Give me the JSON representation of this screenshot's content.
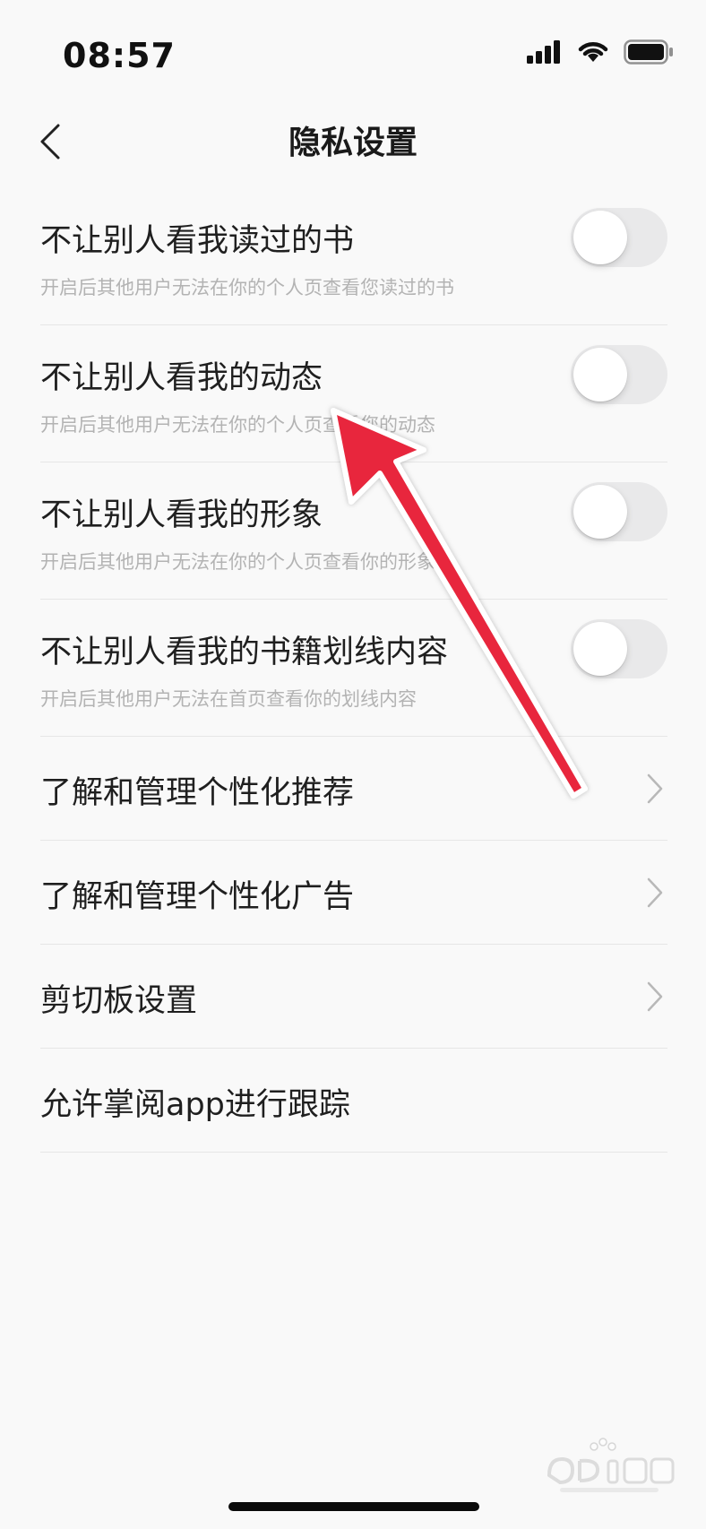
{
  "status_bar": {
    "time": "08:57",
    "icons": [
      "cellular-signal-icon",
      "wifi-icon",
      "battery-icon"
    ]
  },
  "nav": {
    "title": "隐私设置",
    "back_icon": "chevron-left-icon"
  },
  "toggle_items": [
    {
      "title": "不让别人看我读过的书",
      "description": "开启后其他用户无法在你的个人页查看您读过的书",
      "enabled": false
    },
    {
      "title": "不让别人看我的动态",
      "description": "开启后其他用户无法在你的个人页查看您的动态",
      "enabled": false
    },
    {
      "title": "不让别人看我的形象",
      "description": "开启后其他用户无法在你的个人页查看你的形象",
      "enabled": false
    },
    {
      "title": "不让别人看我的书籍划线内容",
      "description": "开启后其他用户无法在首页查看你的划线内容",
      "enabled": false
    }
  ],
  "link_items": [
    {
      "title": "了解和管理个性化推荐",
      "has_chevron": true
    },
    {
      "title": "了解和管理个性化广告",
      "has_chevron": true
    },
    {
      "title": "剪切板设置",
      "has_chevron": true
    },
    {
      "title": "允许掌阅app进行跟踪",
      "has_chevron": false
    }
  ],
  "colors": {
    "background": "#f9f9f9",
    "switch_off": "#e9e9ea",
    "annotation_arrow": "#e8283e"
  }
}
